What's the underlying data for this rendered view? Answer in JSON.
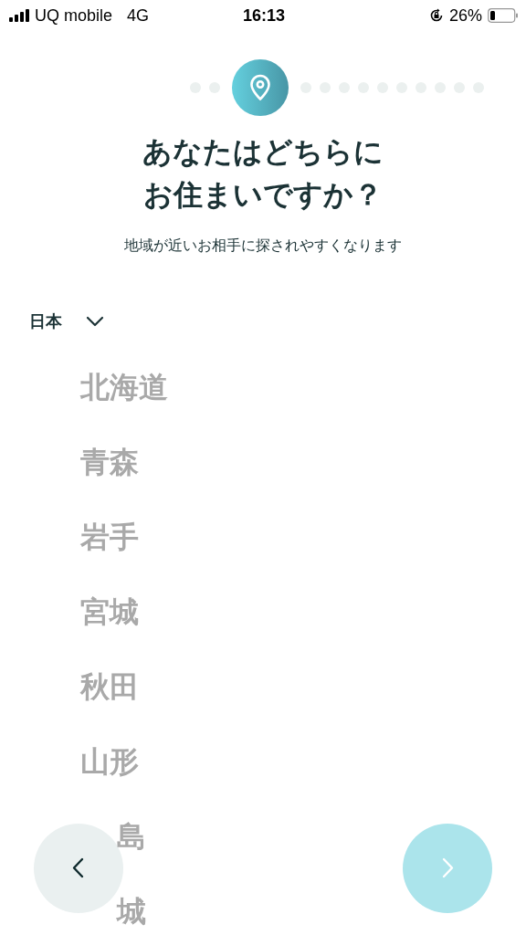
{
  "status_bar": {
    "carrier": "UQ mobile",
    "network": "4G",
    "time": "16:13",
    "battery": "26%"
  },
  "steps": [
    {
      "selected": false
    },
    {
      "selected": false
    },
    {
      "selected": true
    },
    {
      "selected": false
    },
    {
      "selected": false
    },
    {
      "selected": false
    },
    {
      "selected": false
    },
    {
      "selected": false
    },
    {
      "selected": false
    },
    {
      "selected": false
    },
    {
      "selected": false
    },
    {
      "selected": false
    },
    {
      "selected": false
    }
  ],
  "title_lines": [
    "あなたはどちらに",
    "お住まいですか？"
  ],
  "subtitle": "地域が近いお相手に探されやすくなります",
  "country": "日本",
  "regions": [
    {
      "name": "北海道",
      "kind": "full"
    },
    {
      "name": "青森",
      "kind": "full"
    },
    {
      "name": "岩手",
      "kind": "full"
    },
    {
      "name": "宮城",
      "kind": "full"
    },
    {
      "name": "秋田",
      "kind": "full"
    },
    {
      "name": "山形",
      "kind": "full"
    },
    {
      "name": "島",
      "kind": "partial"
    },
    {
      "name": "城",
      "kind": "partial"
    }
  ],
  "back_button": {
    "disabled": false
  },
  "next_button": {
    "disabled": true
  }
}
